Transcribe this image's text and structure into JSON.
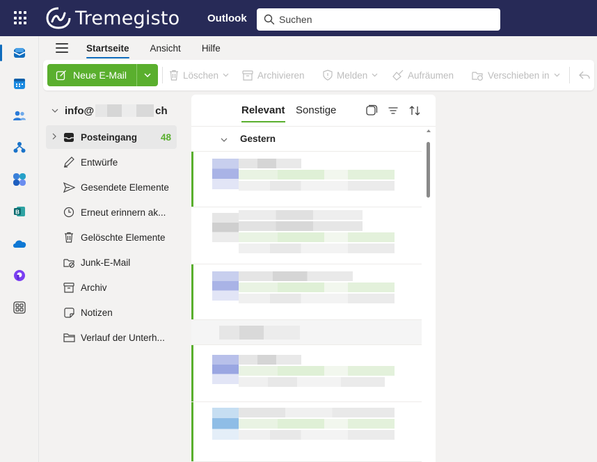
{
  "topbar": {
    "brand": "Tremegisto",
    "app_name": "Outlook",
    "search_placeholder": "Suchen",
    "waffle_icon": "waffle-icon",
    "bg_color": "#272a57"
  },
  "rail": {
    "items": [
      "mail-icon",
      "calendar-icon",
      "people-icon",
      "org-icon",
      "copilot-icon",
      "bookings-icon",
      "onedrive-icon",
      "loop-icon",
      "more-apps-icon"
    ]
  },
  "ribbon": {
    "tabs": [
      "Startseite",
      "Ansicht",
      "Hilfe"
    ],
    "active_tab": "Startseite",
    "new_mail": "Neue E-Mail",
    "delete": "Löschen",
    "archive": "Archivieren",
    "report": "Melden",
    "sweep": "Aufräumen",
    "move": "Verschieben in"
  },
  "account": {
    "prefix": "info@",
    "suffix": "ch"
  },
  "folders": [
    {
      "name": "Posteingang",
      "count": "48",
      "icon": "inbox-icon"
    },
    {
      "name": "Entwürfe",
      "icon": "drafts-icon"
    },
    {
      "name": "Gesendete Elemente",
      "icon": "sent-icon"
    },
    {
      "name": "Erneut erinnern ak...",
      "icon": "clock-icon"
    },
    {
      "name": "Gelöschte Elemente",
      "icon": "trash-icon"
    },
    {
      "name": "Junk-E-Mail",
      "icon": "junk-icon"
    },
    {
      "name": "Archiv",
      "icon": "archive-icon"
    },
    {
      "name": "Notizen",
      "icon": "notes-icon"
    },
    {
      "name": "Verlauf der Unterh...",
      "icon": "folder-icon"
    }
  ],
  "list": {
    "pivots": [
      "Relevant",
      "Sonstige"
    ],
    "active_pivot": "Relevant",
    "group": "Gestern",
    "accent_color": "#5aaf2e"
  }
}
